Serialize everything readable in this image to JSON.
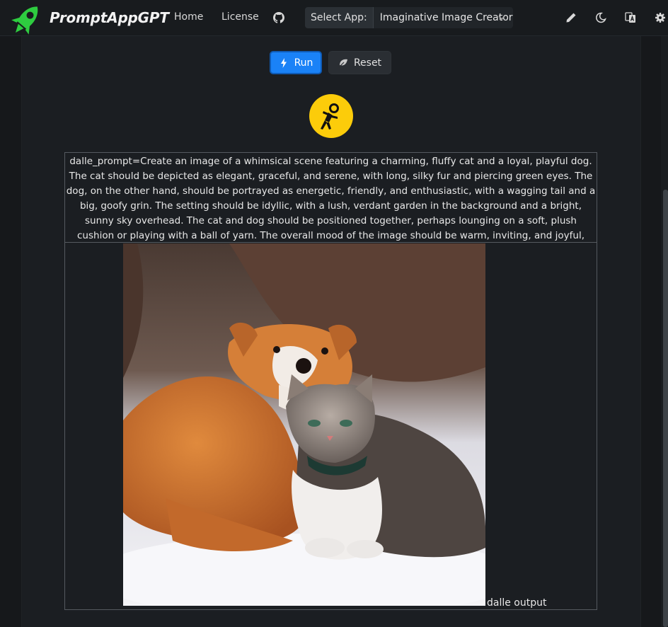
{
  "brand": {
    "name": "PromptAppGPT"
  },
  "nav": {
    "links": [
      "Home",
      "License"
    ],
    "github_icon": "github-icon",
    "select_label": "Select App:",
    "selected_app": "Imaginative Image Creator",
    "right_icons": [
      "pencil-icon",
      "moon-icon",
      "translate-icon",
      "gear-icon"
    ]
  },
  "actions": {
    "run_label": "Run",
    "reset_label": "Reset"
  },
  "colors": {
    "accent": "#1a82f7",
    "avatar": "#fccc0a",
    "brand_green": "#2ecc40"
  },
  "output": {
    "prompt": "dalle_prompt=Create an image of a whimsical scene featuring a charming, fluffy cat and a loyal, playful dog. The cat should be depicted as elegant, graceful, and serene, with long, silky fur and piercing green eyes. The dog, on the other hand, should be portrayed as energetic, friendly, and enthusiastic, with a wagging tail and a big, goofy grin. The setting should be idyllic, with a lush, verdant garden in the background and a bright, sunny sky overhead. The cat and dog should be positioned together, perhaps lounging on a soft, plush cushion or playing with a ball of yarn. The overall mood of the image should be warm, inviting, and joyful, evoking feelings of love, companionship, and contentment.",
    "image_alt": "dalle output"
  }
}
